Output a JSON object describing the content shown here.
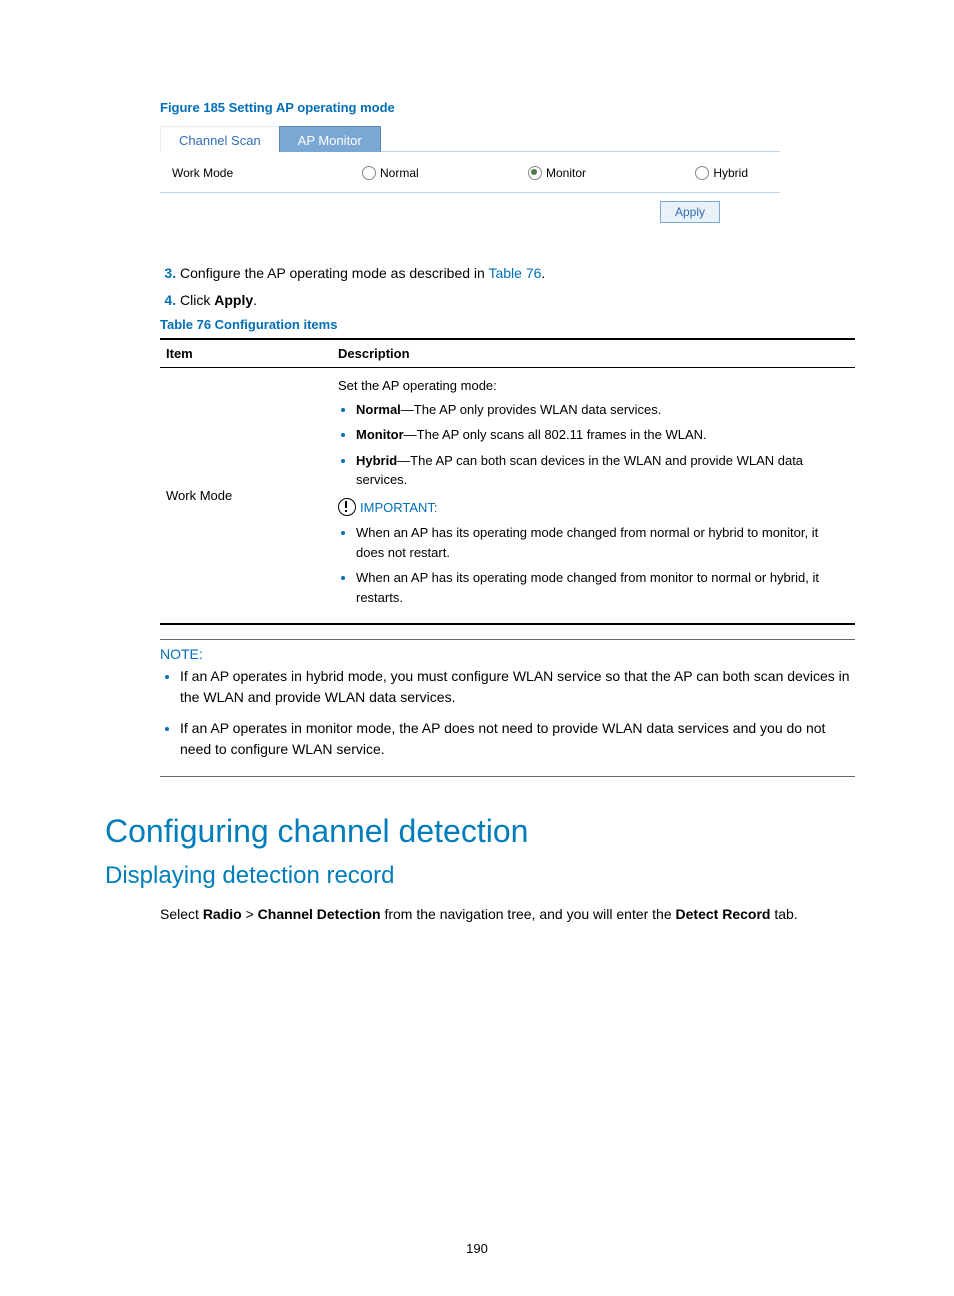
{
  "figure_caption": "Figure 185 Setting AP operating mode",
  "screenshot": {
    "tabs": {
      "channel_scan": "Channel Scan",
      "ap_monitor": "AP Monitor"
    },
    "work_mode_label": "Work Mode",
    "options": {
      "normal": "Normal",
      "monitor": "Monitor",
      "hybrid": "Hybrid"
    },
    "apply": "Apply"
  },
  "steps": {
    "s3_pre": "Configure the AP operating mode as described in ",
    "s3_link": "Table 76",
    "s3_post": ".",
    "s4_pre": "Click ",
    "s4_bold": "Apply",
    "s4_post": "."
  },
  "table_caption": "Table 76 Configuration items",
  "table": {
    "h1": "Item",
    "h2": "Description",
    "row_item": "Work Mode",
    "desc_intro": "Set the AP operating mode:",
    "b1_label": "Normal",
    "b1_rest": "—The AP only provides WLAN data services.",
    "b2_label": "Monitor",
    "b2_rest": "—The AP only scans all 802.11 frames in the WLAN.",
    "b3_label": "Hybrid",
    "b3_rest": "—The AP can both scan devices in the WLAN and provide WLAN data services.",
    "important": "IMPORTANT:",
    "i1": "When an AP has its operating mode changed from normal or hybrid to monitor, it does not restart.",
    "i2": "When an AP has its operating mode changed from monitor to normal or hybrid, it restarts."
  },
  "note": {
    "label": "NOTE:",
    "n1": "If an AP operates in hybrid mode, you must configure WLAN service so that the AP can both scan devices in the WLAN and provide WLAN data services.",
    "n2": "If an AP operates in monitor mode, the AP does not need to provide WLAN data services and you do not need to configure WLAN service."
  },
  "h1": "Configuring channel detection",
  "h2": "Displaying detection record",
  "body": {
    "p1_pre": "Select ",
    "p1_radio": "Radio",
    "p1_gt": " > ",
    "p1_cd": "Channel Detection",
    "p1_mid": " from the navigation tree, and you will enter the ",
    "p1_dr": "Detect Record",
    "p1_post": " tab."
  },
  "page_number": "190"
}
